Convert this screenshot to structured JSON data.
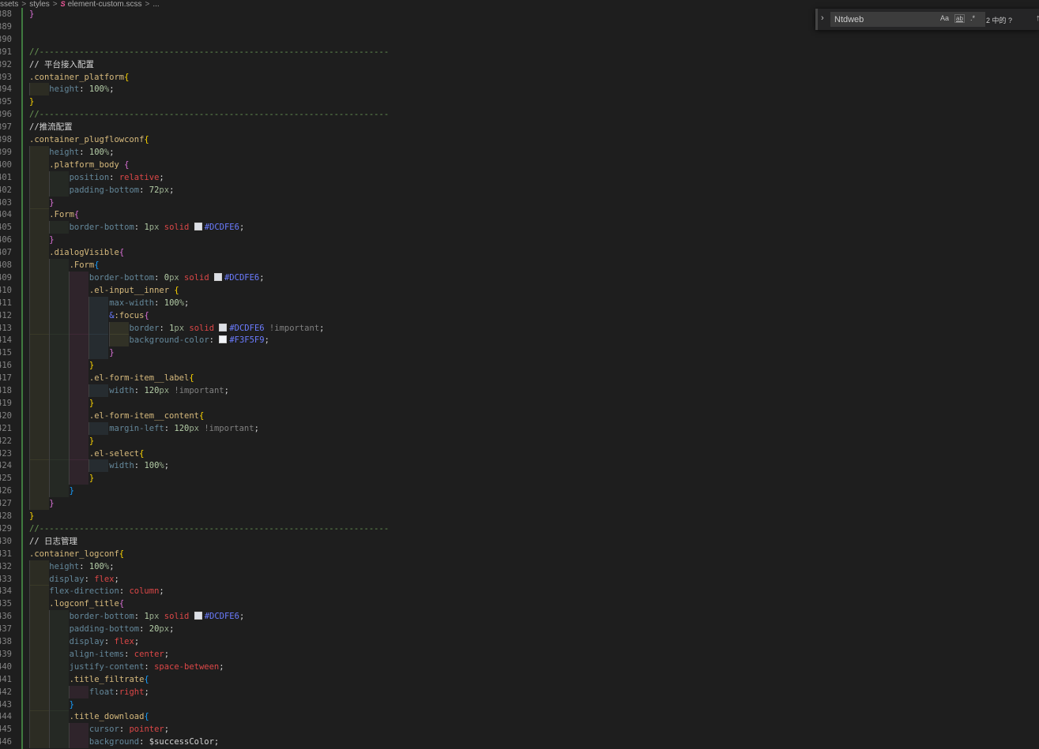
{
  "breadcrumb": {
    "items": [
      "ssets",
      "styles",
      "element-custom.scss",
      "..."
    ],
    "file_icon": "scss-file-icon"
  },
  "find_widget": {
    "query": "Ntdweb",
    "match_case": "Aa",
    "whole_word": "ab",
    "regex": ".*",
    "result_count": "2 中的 ?"
  },
  "colors": {
    "background": "#1e1e1e",
    "selector": "#d7ba7d",
    "property": "#9cdcfe",
    "number": "#b5cea8",
    "keyword": "#f14c4c",
    "hex": "#6b7cff",
    "swatch_dcdfe6": "#DCDFE6",
    "swatch_f3f5f9": "#F3F5F9"
  },
  "lines": [
    {
      "n": "388",
      "indent": 0,
      "tokens": [
        [
          "b2",
          "}"
        ]
      ]
    },
    {
      "n": "389",
      "indent": 0,
      "tokens": []
    },
    {
      "n": "390",
      "indent": 0,
      "tokens": []
    },
    {
      "n": "391",
      "indent": 0,
      "tokens": [
        [
          "cm",
          "//----------------------------------------------------------------------"
        ]
      ]
    },
    {
      "n": "392",
      "indent": 0,
      "tokens": [
        [
          "cmcn",
          "// 平台接入配置"
        ]
      ]
    },
    {
      "n": "393",
      "indent": 0,
      "tokens": [
        [
          "sel",
          ".container_platform"
        ],
        [
          "b1",
          "{"
        ]
      ]
    },
    {
      "n": "394",
      "indent": 1,
      "tokens": [
        [
          "prop",
          "height"
        ],
        [
          "var",
          ": "
        ],
        [
          "num",
          "100"
        ],
        [
          "unit",
          "%"
        ],
        [
          "var",
          ";"
        ]
      ]
    },
    {
      "n": "395",
      "indent": 0,
      "tokens": [
        [
          "b1",
          "}"
        ]
      ]
    },
    {
      "n": "396",
      "indent": 0,
      "tokens": [
        [
          "cm",
          "//----------------------------------------------------------------------"
        ]
      ]
    },
    {
      "n": "397",
      "indent": 0,
      "tokens": [
        [
          "cmcn",
          "//推流配置"
        ]
      ]
    },
    {
      "n": "398",
      "indent": 0,
      "tokens": [
        [
          "sel",
          ".container_plugflowconf"
        ],
        [
          "b1",
          "{"
        ]
      ]
    },
    {
      "n": "399",
      "indent": 1,
      "tokens": [
        [
          "prop",
          "height"
        ],
        [
          "var",
          ": "
        ],
        [
          "num",
          "100"
        ],
        [
          "unit",
          "%"
        ],
        [
          "var",
          ";"
        ]
      ]
    },
    {
      "n": "400",
      "indent": 1,
      "tokens": [
        [
          "sel",
          ".platform_body "
        ],
        [
          "b2",
          "{"
        ]
      ]
    },
    {
      "n": "401",
      "indent": 2,
      "tokens": [
        [
          "prop",
          "position"
        ],
        [
          "var",
          ": "
        ],
        [
          "kwr",
          "relative"
        ],
        [
          "var",
          ";"
        ]
      ]
    },
    {
      "n": "402",
      "indent": 2,
      "tokens": [
        [
          "prop",
          "padding-bottom"
        ],
        [
          "var",
          ": "
        ],
        [
          "num",
          "72"
        ],
        [
          "unit",
          "px"
        ],
        [
          "var",
          ";"
        ]
      ]
    },
    {
      "n": "403",
      "indent": 1,
      "tokens": [
        [
          "b2",
          "}"
        ]
      ]
    },
    {
      "n": "404",
      "indent": 1,
      "tokens": [
        [
          "sel",
          ".Form"
        ],
        [
          "b2",
          "{"
        ]
      ]
    },
    {
      "n": "405",
      "indent": 2,
      "tokens": [
        [
          "prop",
          "border-bottom"
        ],
        [
          "var",
          ": "
        ],
        [
          "num",
          "1"
        ],
        [
          "unit",
          "px"
        ],
        [
          "var",
          " "
        ],
        [
          "kwr",
          "solid"
        ],
        [
          "var",
          " "
        ],
        [
          "swatch",
          "#DCDFE6"
        ],
        [
          "hex",
          "#DCDFE6"
        ],
        [
          "var",
          ";"
        ]
      ]
    },
    {
      "n": "406",
      "indent": 1,
      "tokens": [
        [
          "b2",
          "}"
        ]
      ]
    },
    {
      "n": "407",
      "indent": 1,
      "tokens": [
        [
          "sel",
          ".dialogVisible"
        ],
        [
          "b2",
          "{"
        ]
      ]
    },
    {
      "n": "408",
      "indent": 2,
      "tokens": [
        [
          "sel",
          ".Form"
        ],
        [
          "b3",
          "{"
        ]
      ]
    },
    {
      "n": "409",
      "indent": 3,
      "tokens": [
        [
          "prop",
          "border-bottom"
        ],
        [
          "var",
          ": "
        ],
        [
          "num",
          "0"
        ],
        [
          "unit",
          "px"
        ],
        [
          "var",
          " "
        ],
        [
          "kwr",
          "solid"
        ],
        [
          "var",
          " "
        ],
        [
          "swatch",
          "#DCDFE6"
        ],
        [
          "hex",
          "#DCDFE6"
        ],
        [
          "var",
          ";"
        ]
      ]
    },
    {
      "n": "410",
      "indent": 3,
      "tokens": [
        [
          "sel",
          ".el-input__inner "
        ],
        [
          "b1",
          "{"
        ]
      ]
    },
    {
      "n": "411",
      "indent": 4,
      "tokens": [
        [
          "prop",
          "max-width"
        ],
        [
          "var",
          ": "
        ],
        [
          "num",
          "100"
        ],
        [
          "unit",
          "%"
        ],
        [
          "var",
          ";"
        ]
      ]
    },
    {
      "n": "412",
      "indent": 4,
      "tokens": [
        [
          "hex",
          "&"
        ],
        [
          "sel",
          ":focus"
        ],
        [
          "b2",
          "{"
        ]
      ]
    },
    {
      "n": "413",
      "indent": 5,
      "tokens": [
        [
          "prop",
          "border"
        ],
        [
          "var",
          ": "
        ],
        [
          "num",
          "1"
        ],
        [
          "unit",
          "px"
        ],
        [
          "var",
          " "
        ],
        [
          "kwr",
          "solid"
        ],
        [
          "var",
          " "
        ],
        [
          "swatch",
          "#DCDFE6"
        ],
        [
          "hex",
          "#DCDFE6"
        ],
        [
          "imp",
          " !important"
        ],
        [
          "var",
          ";"
        ]
      ]
    },
    {
      "n": "414",
      "indent": 5,
      "tokens": [
        [
          "prop",
          "background-color"
        ],
        [
          "var",
          ": "
        ],
        [
          "swatch",
          "#F3F5F9"
        ],
        [
          "hex",
          "#F3F5F9"
        ],
        [
          "var",
          ";"
        ]
      ]
    },
    {
      "n": "415",
      "indent": 4,
      "tokens": [
        [
          "b2",
          "}"
        ]
      ]
    },
    {
      "n": "416",
      "indent": 3,
      "tokens": [
        [
          "b1",
          "}"
        ]
      ]
    },
    {
      "n": "417",
      "indent": 3,
      "tokens": [
        [
          "sel",
          ".el-form-item__label"
        ],
        [
          "b1",
          "{"
        ]
      ]
    },
    {
      "n": "418",
      "indent": 4,
      "tokens": [
        [
          "prop",
          "width"
        ],
        [
          "var",
          ": "
        ],
        [
          "num",
          "120"
        ],
        [
          "unit",
          "px"
        ],
        [
          "imp",
          " !important"
        ],
        [
          "var",
          ";"
        ]
      ]
    },
    {
      "n": "419",
      "indent": 3,
      "tokens": [
        [
          "b1",
          "}"
        ]
      ]
    },
    {
      "n": "420",
      "indent": 3,
      "tokens": [
        [
          "sel",
          ".el-form-item__content"
        ],
        [
          "b1",
          "{"
        ]
      ]
    },
    {
      "n": "421",
      "indent": 4,
      "tokens": [
        [
          "prop",
          "margin-left"
        ],
        [
          "var",
          ": "
        ],
        [
          "num",
          "120"
        ],
        [
          "unit",
          "px"
        ],
        [
          "imp",
          " !important"
        ],
        [
          "var",
          ";"
        ]
      ]
    },
    {
      "n": "422",
      "indent": 3,
      "tokens": [
        [
          "b1",
          "}"
        ]
      ]
    },
    {
      "n": "423",
      "indent": 3,
      "tokens": [
        [
          "sel",
          ".el-select"
        ],
        [
          "b1",
          "{"
        ]
      ]
    },
    {
      "n": "424",
      "indent": 4,
      "tokens": [
        [
          "prop",
          "width"
        ],
        [
          "var",
          ": "
        ],
        [
          "num",
          "100"
        ],
        [
          "unit",
          "%"
        ],
        [
          "var",
          ";"
        ]
      ]
    },
    {
      "n": "425",
      "indent": 3,
      "tokens": [
        [
          "b1",
          "}"
        ]
      ]
    },
    {
      "n": "426",
      "indent": 2,
      "tokens": [
        [
          "b3",
          "}"
        ]
      ]
    },
    {
      "n": "427",
      "indent": 1,
      "tokens": [
        [
          "b2",
          "}"
        ]
      ]
    },
    {
      "n": "428",
      "indent": 0,
      "tokens": [
        [
          "b1",
          "}"
        ]
      ]
    },
    {
      "n": "429",
      "indent": 0,
      "tokens": [
        [
          "cm",
          "//----------------------------------------------------------------------"
        ]
      ]
    },
    {
      "n": "430",
      "indent": 0,
      "tokens": [
        [
          "cmcn",
          "// 日志管理"
        ]
      ]
    },
    {
      "n": "431",
      "indent": 0,
      "tokens": [
        [
          "sel",
          ".container_logconf"
        ],
        [
          "b1",
          "{"
        ]
      ]
    },
    {
      "n": "432",
      "indent": 1,
      "tokens": [
        [
          "prop",
          "height"
        ],
        [
          "var",
          ": "
        ],
        [
          "num",
          "100"
        ],
        [
          "unit",
          "%"
        ],
        [
          "var",
          ";"
        ]
      ]
    },
    {
      "n": "433",
      "indent": 1,
      "tokens": [
        [
          "prop",
          "display"
        ],
        [
          "var",
          ": "
        ],
        [
          "kwr",
          "flex"
        ],
        [
          "var",
          ";"
        ]
      ]
    },
    {
      "n": "434",
      "indent": 1,
      "tokens": [
        [
          "prop",
          "flex-direction"
        ],
        [
          "var",
          ": "
        ],
        [
          "kwr",
          "column"
        ],
        [
          "var",
          ";"
        ]
      ]
    },
    {
      "n": "435",
      "indent": 1,
      "tokens": [
        [
          "sel",
          ".logconf_title"
        ],
        [
          "b2",
          "{"
        ]
      ]
    },
    {
      "n": "436",
      "indent": 2,
      "tokens": [
        [
          "prop",
          "border-bottom"
        ],
        [
          "var",
          ": "
        ],
        [
          "num",
          "1"
        ],
        [
          "unit",
          "px"
        ],
        [
          "var",
          " "
        ],
        [
          "kwr",
          "solid"
        ],
        [
          "var",
          " "
        ],
        [
          "swatch",
          "#DCDFE6"
        ],
        [
          "hex",
          "#DCDFE6"
        ],
        [
          "var",
          ";"
        ]
      ]
    },
    {
      "n": "437",
      "indent": 2,
      "tokens": [
        [
          "prop",
          "padding-bottom"
        ],
        [
          "var",
          ": "
        ],
        [
          "num",
          "20"
        ],
        [
          "unit",
          "px"
        ],
        [
          "var",
          ";"
        ]
      ]
    },
    {
      "n": "438",
      "indent": 2,
      "tokens": [
        [
          "prop",
          "display"
        ],
        [
          "var",
          ": "
        ],
        [
          "kwr",
          "flex"
        ],
        [
          "var",
          ";"
        ]
      ]
    },
    {
      "n": "439",
      "indent": 2,
      "tokens": [
        [
          "prop",
          "align-items"
        ],
        [
          "var",
          ": "
        ],
        [
          "kwr",
          "center"
        ],
        [
          "var",
          ";"
        ]
      ]
    },
    {
      "n": "440",
      "indent": 2,
      "tokens": [
        [
          "prop",
          "justify-content"
        ],
        [
          "var",
          ": "
        ],
        [
          "kwr",
          "space-between"
        ],
        [
          "var",
          ";"
        ]
      ]
    },
    {
      "n": "441",
      "indent": 2,
      "tokens": [
        [
          "sel",
          ".title_filtrate"
        ],
        [
          "b3",
          "{"
        ]
      ]
    },
    {
      "n": "442",
      "indent": 3,
      "tokens": [
        [
          "prop",
          "float"
        ],
        [
          "var",
          ":"
        ],
        [
          "kwr",
          "right"
        ],
        [
          "var",
          ";"
        ]
      ]
    },
    {
      "n": "443",
      "indent": 2,
      "tokens": [
        [
          "b3",
          "}"
        ]
      ]
    },
    {
      "n": "444",
      "indent": 2,
      "tokens": [
        [
          "sel",
          ".title_download"
        ],
        [
          "b3",
          "{"
        ]
      ]
    },
    {
      "n": "445",
      "indent": 3,
      "tokens": [
        [
          "prop",
          "cursor"
        ],
        [
          "var",
          ": "
        ],
        [
          "kwr",
          "pointer"
        ],
        [
          "var",
          ";"
        ]
      ]
    },
    {
      "n": "446",
      "indent": 3,
      "tokens": [
        [
          "prop",
          "background"
        ],
        [
          "var",
          ": $successColor;"
        ]
      ]
    }
  ]
}
